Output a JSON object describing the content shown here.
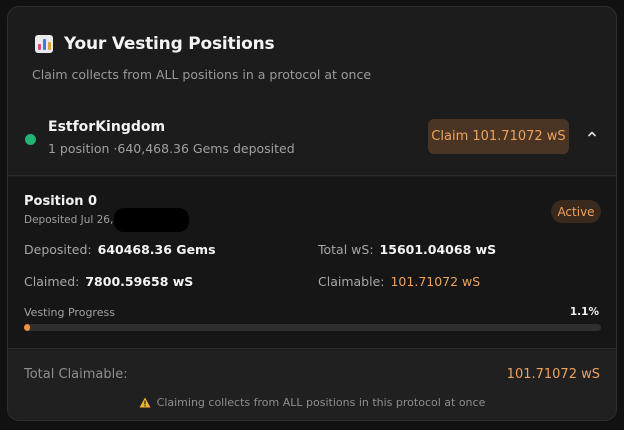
{
  "header": {
    "title": "Your Vesting Positions",
    "icon": "bar-chart-icon",
    "subtitle": "Claim collects from ALL positions in a protocol at once"
  },
  "protocol": {
    "name": "EstforKingdom",
    "meta": "1 position ·640,468.36 Gems deposited",
    "status_color": "#22b473",
    "claim_label": "Claim 101.71072 wS",
    "expand_icon": "chevron-up-icon"
  },
  "position": {
    "title": "Position 0",
    "deposited_date": "Deposited Jul 26,",
    "status": "Active",
    "deposited_label": "Deposited:",
    "deposited_value": "640468.36 Gems",
    "total_label": "Total wS:",
    "total_value": "15601.04068 wS",
    "claimed_label": "Claimed:",
    "claimed_value": "7800.59658 wS",
    "claimable_label": "Claimable:",
    "claimable_value": "101.71072 wS",
    "vesting_label": "Vesting Progress",
    "vesting_pct_text": "1.1%",
    "vesting_progress": 0.011
  },
  "footer": {
    "total_label": "Total Claimable:",
    "total_value": "101.71072 wS",
    "warning_icon": "warning-icon",
    "warning_text": "Claiming collects from ALL positions in this protocol at once"
  },
  "colors": {
    "accent": "#f0a25c",
    "background": "#1c1c1d",
    "success": "#22b473"
  }
}
